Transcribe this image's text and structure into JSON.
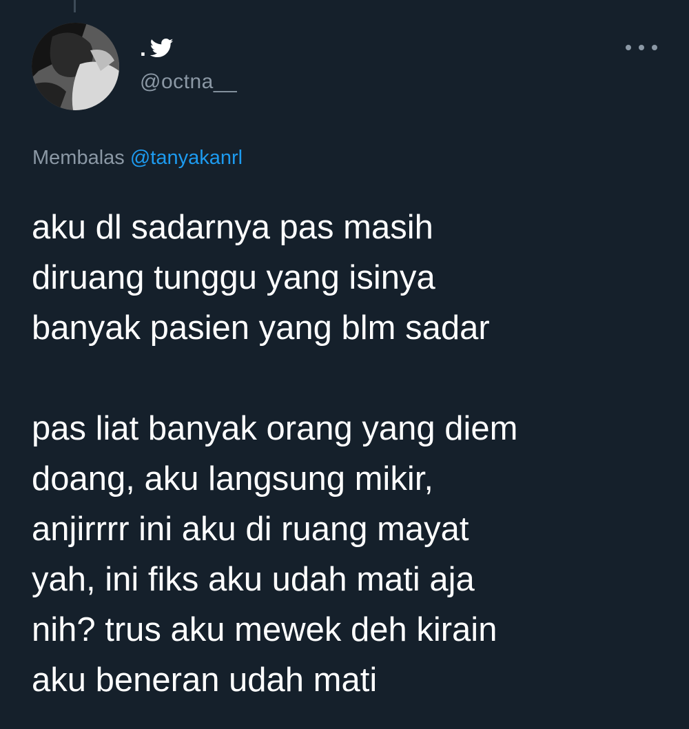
{
  "tweet": {
    "display_name": ".",
    "bird_icon": "twitter-bird-icon",
    "handle": "@octna__",
    "more_icon": "more-options-icon",
    "reply": {
      "prefix": "Membalas",
      "mention": "@tanyakanrl"
    },
    "paragraphs": [
      {
        "lines": [
          "aku dl sadarnya pas masih",
          "diruang tunggu yang isinya",
          "banyak pasien yang blm sadar"
        ]
      },
      {
        "lines": [
          "pas liat banyak orang yang diem",
          "doang, aku langsung mikir,",
          "anjirrrr ini aku di ruang mayat",
          "yah, ini fiks aku udah mati aja",
          "nih? trus aku mewek deh kirain",
          "aku beneran udah mati"
        ]
      }
    ]
  },
  "colors": {
    "background": "#15202b",
    "text_primary": "#ffffff",
    "text_secondary": "#8b98a5",
    "link": "#1d9bf0"
  }
}
